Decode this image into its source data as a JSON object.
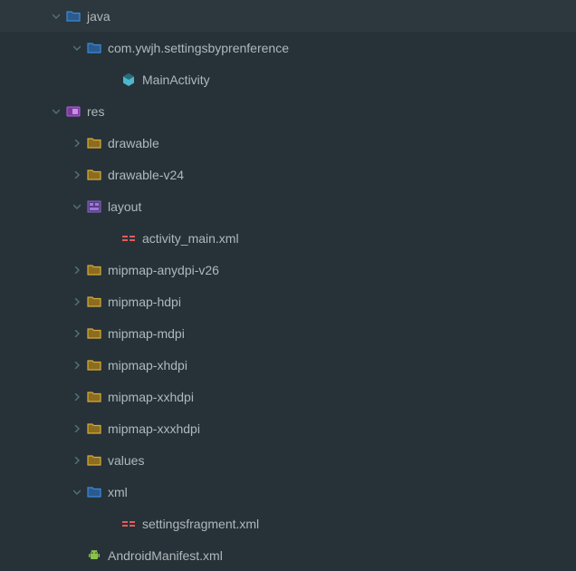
{
  "tree": [
    {
      "label": "java",
      "depth": 0,
      "expanded": true,
      "iconType": "folder-blue",
      "hasChildren": true
    },
    {
      "label": "com.ywjh.settingsbyprenference",
      "depth": 1,
      "expanded": true,
      "iconType": "folder-blue",
      "hasChildren": true
    },
    {
      "label": "MainActivity",
      "depth": 2,
      "expanded": null,
      "iconType": "class-cyan",
      "hasChildren": false
    },
    {
      "label": "res",
      "depth": 0,
      "expanded": true,
      "iconType": "res-purple",
      "hasChildren": true
    },
    {
      "label": "drawable",
      "depth": 1,
      "expanded": false,
      "iconType": "folder-orange",
      "hasChildren": true
    },
    {
      "label": "drawable-v24",
      "depth": 1,
      "expanded": false,
      "iconType": "folder-orange",
      "hasChildren": true
    },
    {
      "label": "layout",
      "depth": 1,
      "expanded": true,
      "iconType": "layout-purple",
      "hasChildren": true
    },
    {
      "label": "activity_main.xml",
      "depth": 2,
      "expanded": null,
      "iconType": "xml-red",
      "hasChildren": false
    },
    {
      "label": "mipmap-anydpi-v26",
      "depth": 1,
      "expanded": false,
      "iconType": "folder-orange",
      "hasChildren": true
    },
    {
      "label": "mipmap-hdpi",
      "depth": 1,
      "expanded": false,
      "iconType": "folder-orange",
      "hasChildren": true
    },
    {
      "label": "mipmap-mdpi",
      "depth": 1,
      "expanded": false,
      "iconType": "folder-orange",
      "hasChildren": true
    },
    {
      "label": "mipmap-xhdpi",
      "depth": 1,
      "expanded": false,
      "iconType": "folder-orange",
      "hasChildren": true
    },
    {
      "label": "mipmap-xxhdpi",
      "depth": 1,
      "expanded": false,
      "iconType": "folder-orange",
      "hasChildren": true
    },
    {
      "label": "mipmap-xxxhdpi",
      "depth": 1,
      "expanded": false,
      "iconType": "folder-orange",
      "hasChildren": true
    },
    {
      "label": "values",
      "depth": 1,
      "expanded": false,
      "iconType": "folder-orange",
      "hasChildren": true
    },
    {
      "label": "xml",
      "depth": 1,
      "expanded": true,
      "iconType": "folder-blue",
      "hasChildren": true
    },
    {
      "label": "settingsfragment.xml",
      "depth": 2,
      "expanded": null,
      "iconType": "xml-red",
      "hasChildren": false
    },
    {
      "label": "AndroidManifest.xml",
      "depth": 1,
      "expanded": null,
      "iconType": "android",
      "hasChildren": false
    }
  ]
}
